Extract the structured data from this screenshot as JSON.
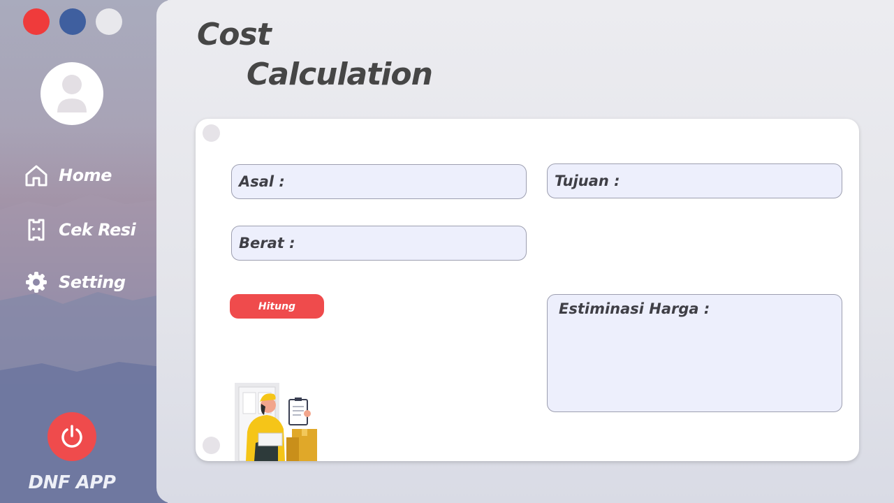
{
  "window_controls": {
    "close_color": "#ef3b3b",
    "minimize_color": "#3f5f9f",
    "maximize_color": "#e8e8ec"
  },
  "sidebar": {
    "items": [
      {
        "label": "Home",
        "icon": "home-icon"
      },
      {
        "label": "Cek Resi",
        "icon": "receipt-icon"
      },
      {
        "label": "Setting",
        "icon": "gear-icon"
      }
    ],
    "power_icon": "power-icon",
    "brand": "DNF APP"
  },
  "page": {
    "title_line1": "Cost",
    "title_line2": "Calculation"
  },
  "form": {
    "origin_label": "Asal :",
    "destination_label": "Tujuan :",
    "weight_label": "Berat :",
    "calculate_button": "Hitung",
    "estimate_label": "Estiminasi Harga :"
  },
  "colors": {
    "accent": "#ef4b4c",
    "field_bg": "#edeffc",
    "title": "#464646"
  }
}
